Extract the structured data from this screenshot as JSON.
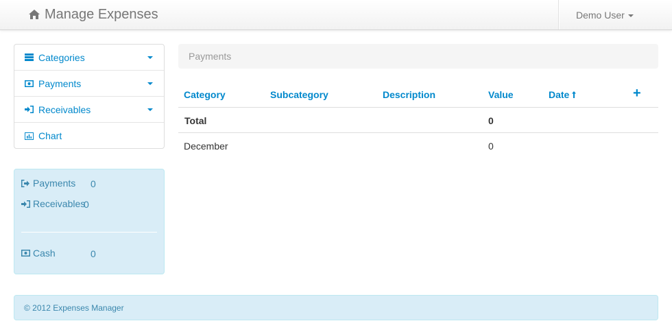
{
  "navbar": {
    "brand": "Manage Expenses",
    "user": "Demo User"
  },
  "sidebar": {
    "items": [
      {
        "label": "Categories",
        "icon": "list-icon",
        "dropdown": true
      },
      {
        "label": "Payments",
        "icon": "money-icon",
        "dropdown": true
      },
      {
        "label": "Receivables",
        "icon": "sign-in-icon",
        "dropdown": true
      },
      {
        "label": "Chart",
        "icon": "bar-chart-icon",
        "dropdown": false
      }
    ]
  },
  "summary": {
    "payments": {
      "label": "Payments",
      "value": "0"
    },
    "receivables": {
      "label": "Receivables",
      "value": "0"
    },
    "cash": {
      "label": "Cash",
      "value": "0"
    }
  },
  "breadcrumb": {
    "label": "Payments"
  },
  "table": {
    "headers": {
      "category": "Category",
      "subcategory": "Subcategory",
      "description": "Description",
      "value": "Value",
      "date": "Date"
    },
    "rows": [
      {
        "category": "Total",
        "value": "0",
        "bold": true
      },
      {
        "category": "December",
        "value": "0",
        "bold": false
      }
    ]
  },
  "footer": {
    "text": "© 2012 Expenses Manager"
  },
  "colors": {
    "link": "#0088cc",
    "info_bg": "#d9edf7",
    "info_text": "#3a87ad"
  }
}
